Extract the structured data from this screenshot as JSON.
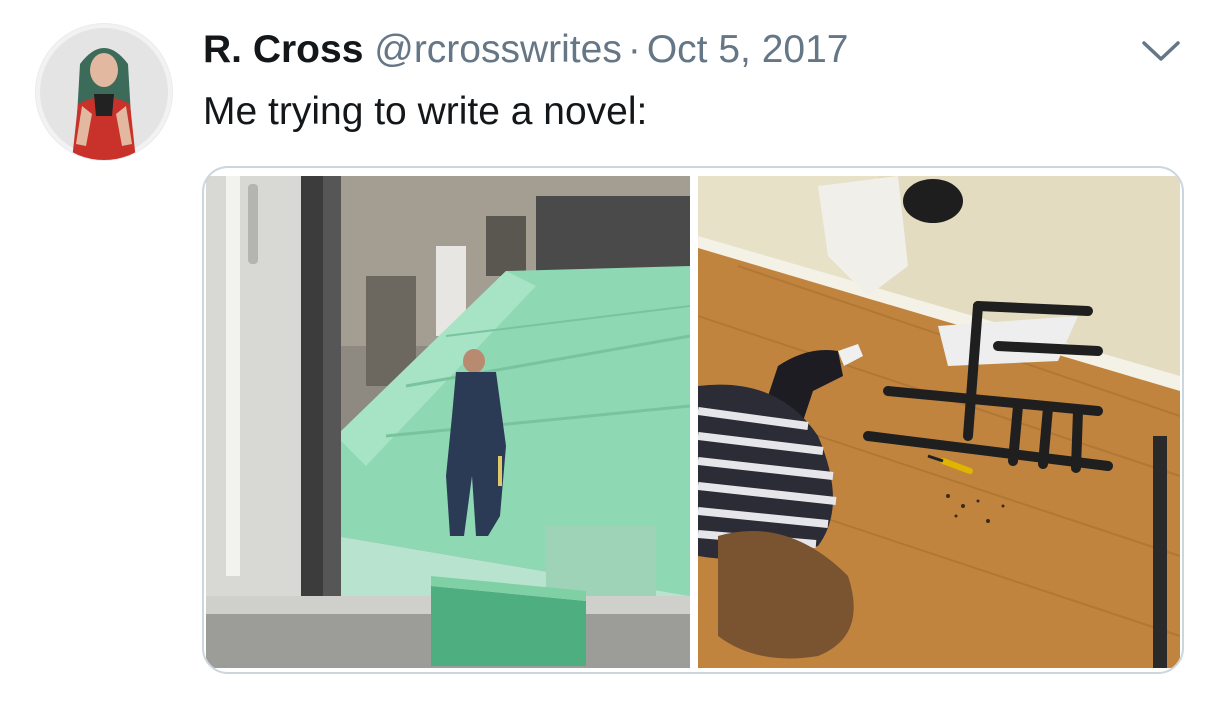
{
  "tweet": {
    "display_name": "R. Cross",
    "handle": "@rcrosswrites",
    "separator": "·",
    "date": "Oct 5, 2017",
    "text": "Me trying to write a novel:"
  },
  "icons": {
    "caret": "chevron-down-icon"
  },
  "colors": {
    "name": "#14171a",
    "secondary": "#657786",
    "media_border": "#ccd6dd"
  }
}
